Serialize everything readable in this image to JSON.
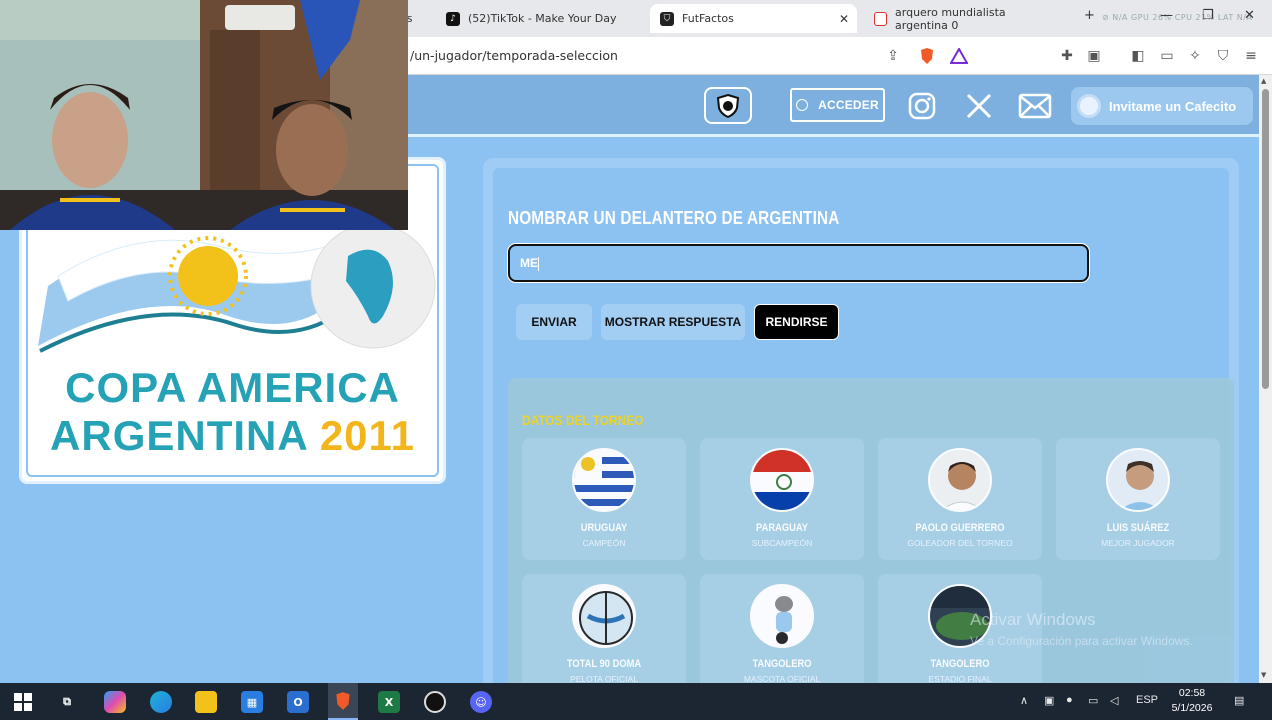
{
  "browser": {
    "tabs": [
      {
        "label": "(52)TikTok - Make Your Day",
        "icon": "tiktok-icon"
      },
      {
        "label": "FutFactos",
        "icon": "futfactos-icon",
        "active": true
      },
      {
        "label": "arquero mundialista argentina 0",
        "icon": "search-icon"
      }
    ],
    "tab_stub": "es",
    "sysmon": "⊘ N/A   GPU 26%   CPU 21%   LAT N/A",
    "url": "/un-jugador/temporada-seleccion"
  },
  "site": {
    "acceder_label": "ACCEDER",
    "cafecito_label": "Invitame un Cafecito"
  },
  "logo_card": {
    "line1": "COPA AMERICA",
    "line2": "ARGENTINA",
    "year": "2011"
  },
  "quiz": {
    "question": "NOMBRAR UN DELANTERO DE ARGENTINA",
    "answer_value": "ME",
    "buttons": {
      "enviar": "ENVIAR",
      "mostrar": "MOSTRAR RESPUESTA",
      "rendirse": "RENDIRSE"
    }
  },
  "datos": {
    "title": "DATOS DEL TORNEO",
    "cards": [
      {
        "name": "URUGUAY",
        "sub": "CAMPEÓN"
      },
      {
        "name": "PARAGUAY",
        "sub": "SUBCAMPEÓN"
      },
      {
        "name": "PAOLO GUERRERO",
        "sub": "GOLEADOR DEL TORNEO"
      },
      {
        "name": "LUIS SUÁREZ",
        "sub": "MEJOR JUGADOR"
      },
      {
        "name": "TOTAL 90 DOMA",
        "sub": "PELOTA OFICIAL"
      },
      {
        "name": "TANGOLERO",
        "sub": "MASCOTA OFICIAL"
      },
      {
        "name": "TANGOLERO",
        "sub": "ESTADIO FINAL"
      }
    ]
  },
  "watermark": {
    "line1": "Activar Windows",
    "line2": "Ve a Configuración para activar Windows."
  },
  "taskbar": {
    "lang": "ESP",
    "time": "02:58",
    "date": "5/1/2026"
  }
}
